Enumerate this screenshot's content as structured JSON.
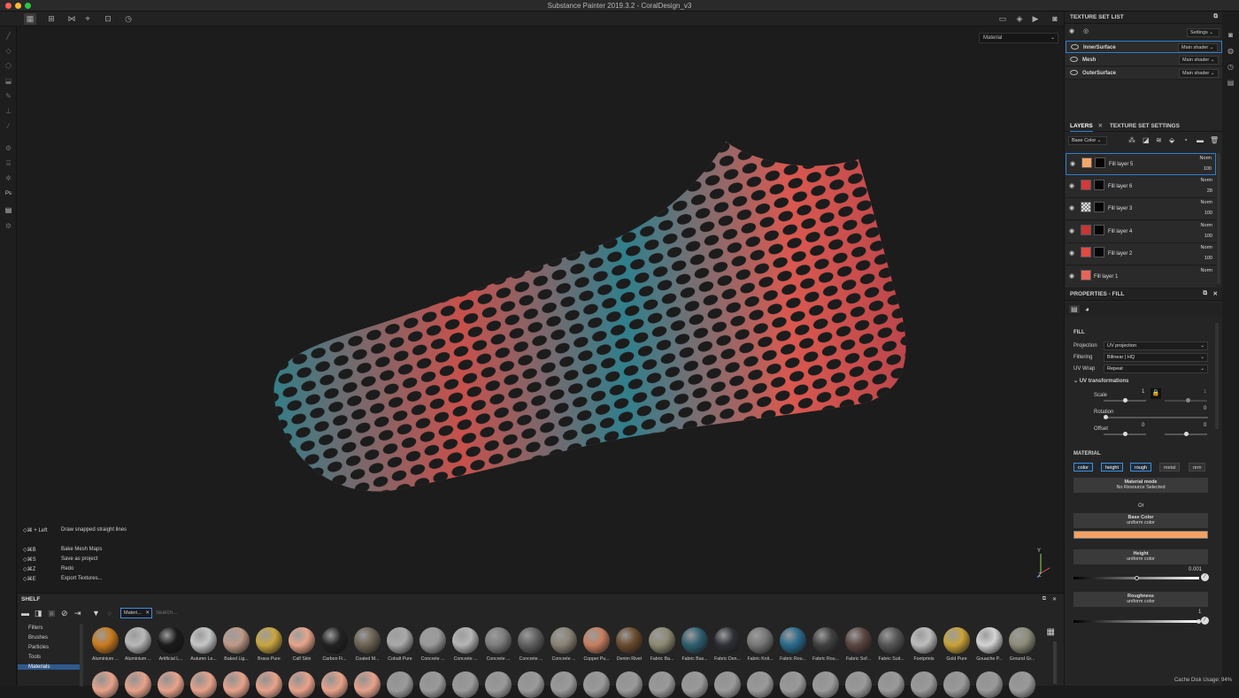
{
  "window": {
    "title": "Substance Painter 2019.3.2 - CoralDesign_v3"
  },
  "viewport": {
    "material_mode": "Material",
    "shortcuts": [
      {
        "keys": "◇⌘ + Left",
        "action": "Draw snapped straight lines"
      },
      {
        "keys": "◇⌘B",
        "action": "Bake Mesh Maps"
      },
      {
        "keys": "◇⌘S",
        "action": "Save as project"
      },
      {
        "keys": "◇⌘Z",
        "action": "Redo"
      },
      {
        "keys": "◇⌘E",
        "action": "Export Textures..."
      }
    ],
    "gizmo": {
      "y": "Y",
      "z": "Z"
    }
  },
  "texture_set_list": {
    "title": "TEXTURE SET LIST",
    "settings_label": "Settings",
    "items": [
      {
        "name": "InnerSurface",
        "shader": "Main shader"
      },
      {
        "name": "Mesh",
        "shader": "Main shader"
      },
      {
        "name": "OuterSurface",
        "shader": "Main shader"
      }
    ]
  },
  "layers": {
    "tab_layers": "LAYERS",
    "tab_settings": "TEXTURE SET SETTINGS",
    "channel": "Base Color",
    "items": [
      {
        "name": "Fill layer 5",
        "blend": "Norm",
        "opacity": "100",
        "color": "#f4a66a"
      },
      {
        "name": "Fill layer 6",
        "blend": "Norm",
        "opacity": "28",
        "color": "#d33a3a"
      },
      {
        "name": "Fill layer 3",
        "blend": "Norm",
        "opacity": "100",
        "color": "#cccccc"
      },
      {
        "name": "Fill layer 4",
        "blend": "Norm",
        "opacity": "100",
        "color": "#c93434"
      },
      {
        "name": "Fill layer 2",
        "blend": "Norm",
        "opacity": "100",
        "color": "#e24a45"
      },
      {
        "name": "Fill layer 1",
        "blend": "Norm",
        "opacity": "",
        "color": "#e8645a"
      }
    ]
  },
  "properties": {
    "title": "PROPERTIES - FILL",
    "fill_label": "FILL",
    "projection_label": "Projection",
    "projection_value": "UV projection",
    "filtering_label": "Filtering",
    "filtering_value": "Bilinear | HQ",
    "uvwrap_label": "UV Wrap",
    "uvwrap_value": "Repeat",
    "uv_transformations": "UV transformations",
    "scale_label": "Scale",
    "scale_value": "1",
    "scale_value2": "1",
    "scale_level": 0.5,
    "rotation_label": "Rotation",
    "rotation_value": "0",
    "rotation_level": 0,
    "offset_label": "Offset",
    "offset_x": "0",
    "offset_y": "0",
    "material_label": "MATERIAL",
    "channels": [
      "color",
      "height",
      "rough",
      "metal",
      "nrm"
    ],
    "channels_on": [
      true,
      true,
      true,
      false,
      false
    ],
    "material_mode_label": "Material mode",
    "material_mode_value": "No Resource Selected",
    "or_label": "Or",
    "base_color_label": "Base Color",
    "base_color_mode": "uniform color",
    "base_color_value": "#f4a262",
    "height_label": "Height",
    "height_mode": "uniform color",
    "height_value": "0.001",
    "roughness_label": "Roughness",
    "roughness_mode": "uniform color",
    "roughness_value": "1"
  },
  "shelf": {
    "title": "SHELF",
    "filter_chip": "Materi...",
    "search_placeholder": "Search...",
    "categories": [
      "Filters",
      "Brushes",
      "Particles",
      "Tools",
      "Materials"
    ],
    "selected_category": "Materials",
    "materials": [
      {
        "name": "Aluminium ...",
        "color": "#c97b1e"
      },
      {
        "name": "Aluminium ...",
        "color": "#b8b8b8"
      },
      {
        "name": "Artificial L...",
        "color": "#1a1a1a"
      },
      {
        "name": "Autumn Le...",
        "color": "#c6c6c6"
      },
      {
        "name": "Baked Lig...",
        "color": "#bf9a86"
      },
      {
        "name": "Brass Pure",
        "color": "#c9a640"
      },
      {
        "name": "Calf Skin",
        "color": "#e7a58b"
      },
      {
        "name": "Carbon Fi...",
        "color": "#222222"
      },
      {
        "name": "Coated M...",
        "color": "#6c6252"
      },
      {
        "name": "Cobalt Pure",
        "color": "#a9a9a9"
      },
      {
        "name": "Concrete ...",
        "color": "#9a9a9a"
      },
      {
        "name": "Concrete ...",
        "color": "#b5b5b5"
      },
      {
        "name": "Concrete ...",
        "color": "#7d7d7d"
      },
      {
        "name": "Concrete ...",
        "color": "#5f5f5f"
      },
      {
        "name": "Concrete ...",
        "color": "#8a8276"
      },
      {
        "name": "Copper Pu...",
        "color": "#c77f5f"
      },
      {
        "name": "Denim Rivet",
        "color": "#6b4b2e"
      },
      {
        "name": "Fabric Ba...",
        "color": "#8d8a73"
      },
      {
        "name": "Fabric Bas...",
        "color": "#2f5e6e"
      },
      {
        "name": "Fabric Den...",
        "color": "#2d3036"
      },
      {
        "name": "Fabric Knit...",
        "color": "#777777"
      },
      {
        "name": "Fabric Rou...",
        "color": "#2a6a8c"
      },
      {
        "name": "Fabric Rou...",
        "color": "#404040"
      },
      {
        "name": "Fabric Sof...",
        "color": "#5a4540"
      },
      {
        "name": "Fabric Suit...",
        "color": "#555555"
      },
      {
        "name": "Footprints",
        "color": "#bdbdbd"
      },
      {
        "name": "Gold Pure",
        "color": "#c9a33a"
      },
      {
        "name": "Gouache P...",
        "color": "#d3d3d3"
      },
      {
        "name": "Ground Gr...",
        "color": "#8e8c7a"
      }
    ]
  },
  "status": {
    "cache": "Cache Disk Usage:   94%"
  },
  "colors": {
    "accent": "#2f7fd0",
    "teal": "#2e7f8a",
    "coral": "#e45b52"
  }
}
